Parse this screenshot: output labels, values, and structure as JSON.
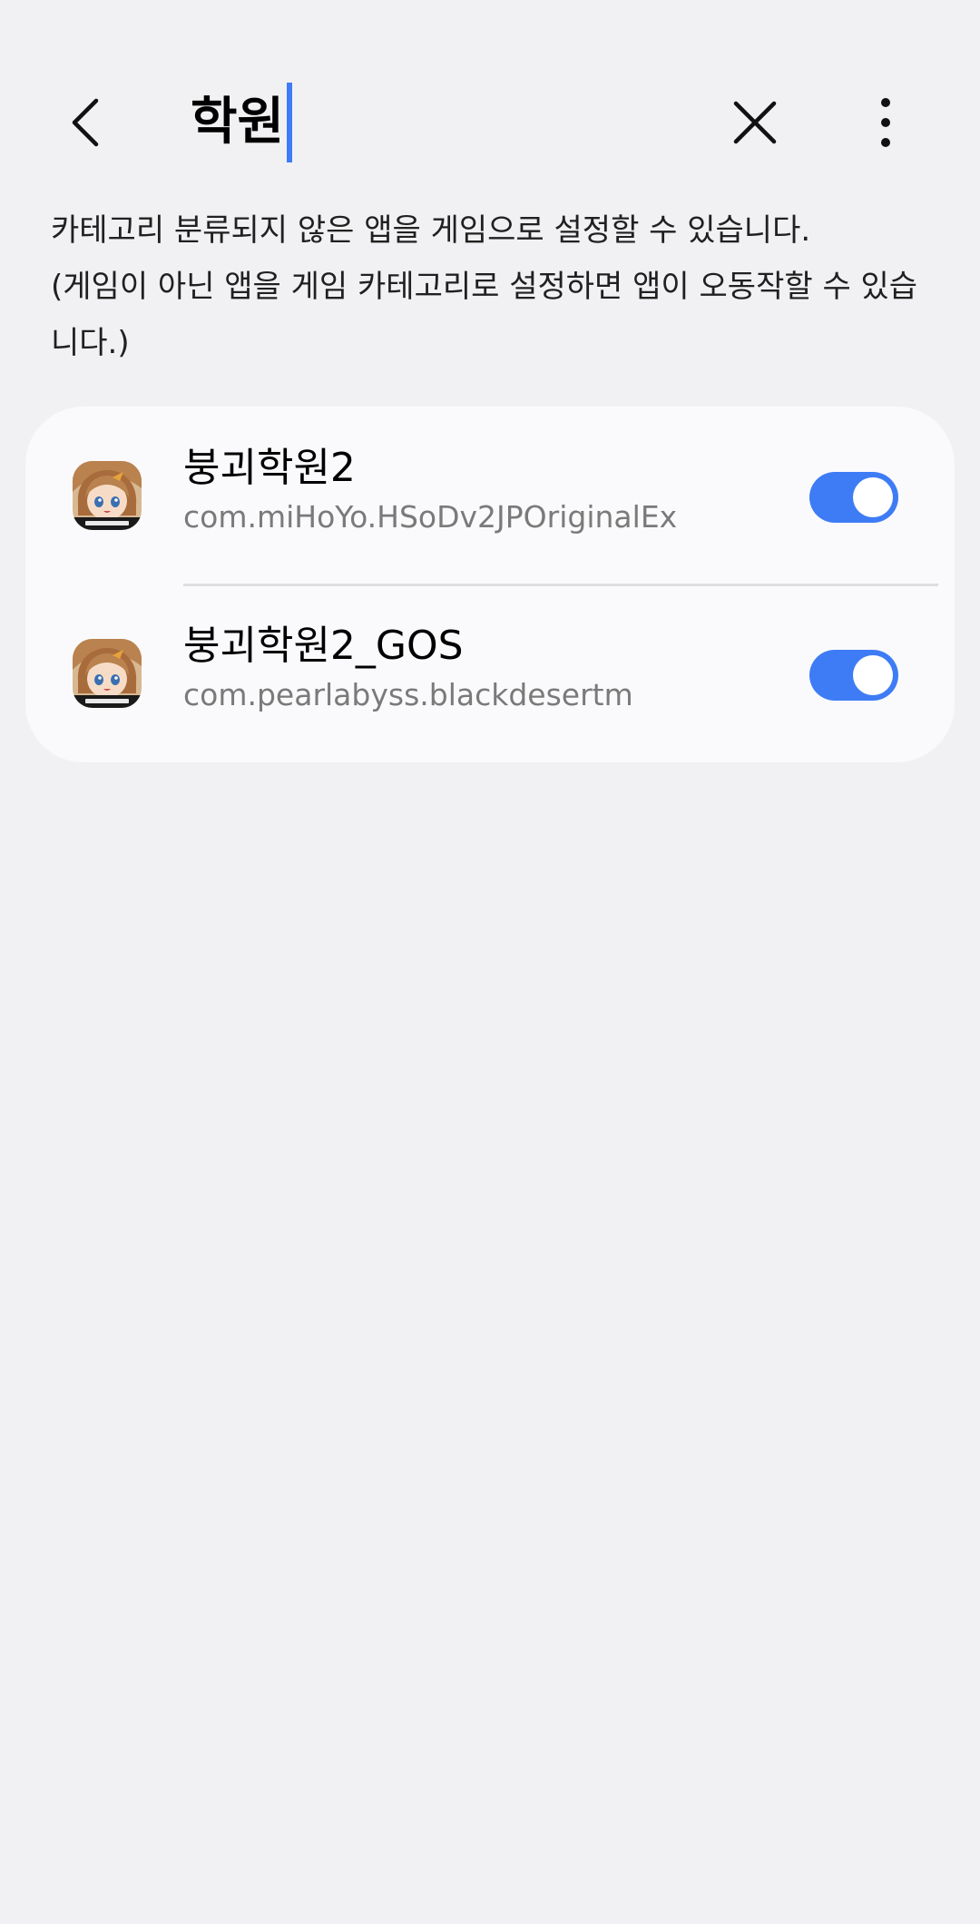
{
  "search": {
    "query": "학원"
  },
  "description": {
    "line1": "카테고리 분류되지 않은 앱을 게임으로 설정할 수 있습니다.",
    "line2": "(게임이 아닌 앱을 게임 카테고리로 설정하면 앱이 오동작할 수 있습니다.)"
  },
  "apps": [
    {
      "name": "붕괴학원2",
      "package": "com.miHoYo.HSoDv2JPOriginalEx",
      "icon": "honkai-gakuen-2-app-icon",
      "toggle_on": true
    },
    {
      "name": "붕괴학원2_GOS",
      "package": "com.pearlabyss.blackdesertm",
      "icon": "honkai-gakuen-2-app-icon",
      "toggle_on": true
    }
  ],
  "icons": {
    "back": "chevron-left-icon",
    "clear": "close-icon",
    "more": "more-vertical-icon"
  },
  "colors": {
    "accent": "#3e7cf5",
    "background": "#f1f1f3",
    "card": "#fafafc",
    "secondary_text": "#7a7a7a"
  }
}
